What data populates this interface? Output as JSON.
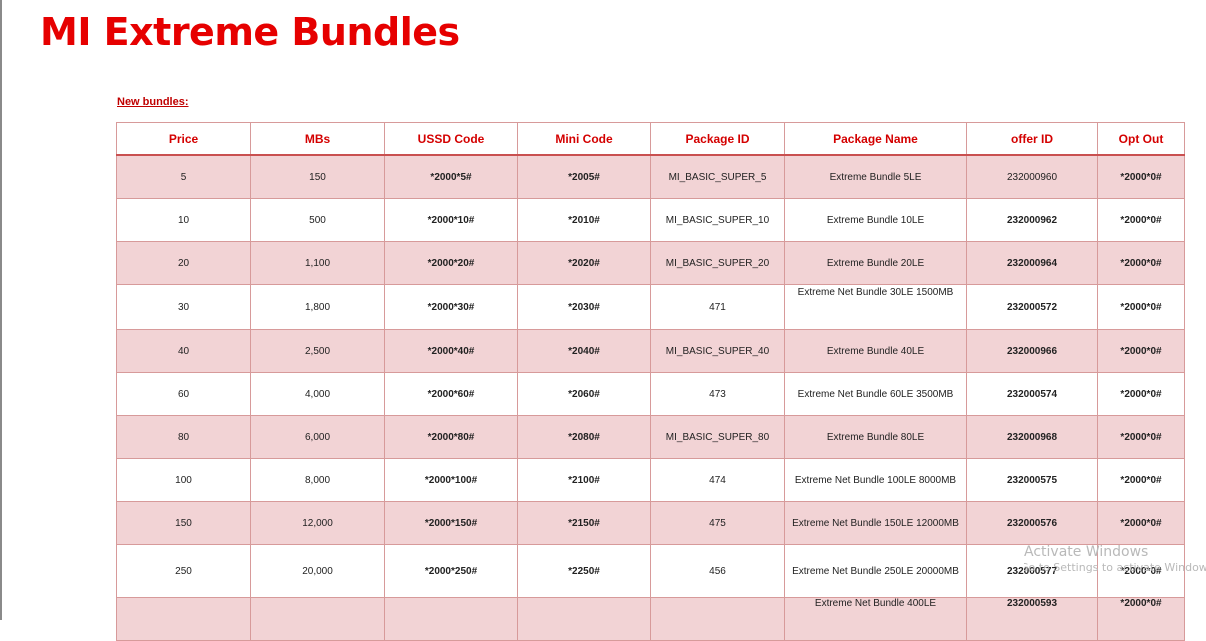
{
  "title": "MI Extreme Bundles",
  "subtitle": "New bundles:",
  "headers": [
    "Price",
    "MBs",
    "USSD Code",
    "Mini Code",
    "Package ID",
    "Package Name",
    "offer ID",
    "Opt Out"
  ],
  "rows": [
    [
      "5",
      "150",
      "*2000*5#",
      "*2005#",
      "MI_BASIC_SUPER_5",
      "Extreme Bundle 5LE",
      "232000960",
      "*2000*0#"
    ],
    [
      "10",
      "500",
      "*2000*10#",
      "*2010#",
      "MI_BASIC_SUPER_10",
      "Extreme Bundle 10LE",
      "232000962",
      "*2000*0#"
    ],
    [
      "20",
      "1,100",
      "*2000*20#",
      "*2020#",
      "MI_BASIC_SUPER_20",
      "Extreme Bundle 20LE",
      "232000964",
      "*2000*0#"
    ],
    [
      "30",
      "1,800",
      "*2000*30#",
      "*2030#",
      "471",
      "Extreme Net Bundle 30LE 1500MB",
      "232000572",
      "*2000*0#"
    ],
    [
      "40",
      "2,500",
      "*2000*40#",
      "*2040#",
      "MI_BASIC_SUPER_40",
      "Extreme Bundle 40LE",
      "232000966",
      "*2000*0#"
    ],
    [
      "60",
      "4,000",
      "*2000*60#",
      "*2060#",
      "473",
      "Extreme Net Bundle 60LE 3500MB",
      "232000574",
      "*2000*0#"
    ],
    [
      "80",
      "6,000",
      "*2000*80#",
      "*2080#",
      "MI_BASIC_SUPER_80",
      "Extreme Bundle 80LE",
      "232000968",
      "*2000*0#"
    ],
    [
      "100",
      "8,000",
      "*2000*100#",
      "*2100#",
      "474",
      "Extreme Net Bundle 100LE 8000MB",
      "232000575",
      "*2000*0#"
    ],
    [
      "150",
      "12,000",
      "*2000*150#",
      "*2150#",
      "475",
      "Extreme Net Bundle 150LE 12000MB",
      "232000576",
      "*2000*0#"
    ],
    [
      "250",
      "20,000",
      "*2000*250#",
      "*2250#",
      "456",
      "Extreme Net Bundle 250LE 20000MB",
      "232000577",
      "*2000*0#"
    ],
    [
      "",
      "",
      "",
      "",
      "",
      "Extreme Net Bundle 400LE",
      "232000593",
      "*2000*0#"
    ]
  ],
  "watermark": {
    "line1": "Activate Windows",
    "line2": "Go to Settings to activate Windows."
  },
  "colors": {
    "title": "#e60000",
    "header_text": "#d40000",
    "row_pink": "#f2d3d5",
    "row_white": "#ffffff",
    "border": "#d79a9a"
  }
}
